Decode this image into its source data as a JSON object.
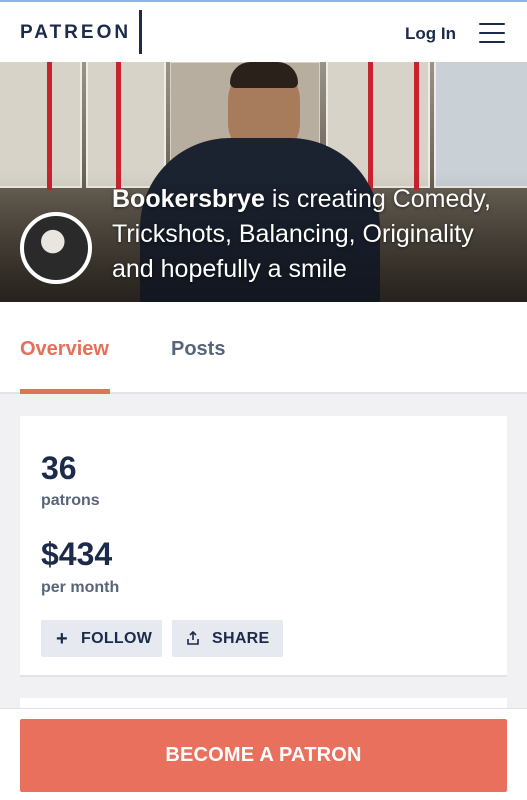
{
  "header": {
    "logo": "PATREON",
    "login_label": "Log In",
    "menu_icon": "hamburger-icon"
  },
  "hero": {
    "creator_name": "Bookersbrye",
    "tagline_prefix": "is creating",
    "tagline": "Comedy, Trickshots, Balancing, Originality and hopefully a smile"
  },
  "tabs": [
    {
      "label": "Overview",
      "active": true
    },
    {
      "label": "Posts",
      "active": false
    }
  ],
  "stats": {
    "patrons_count": "36",
    "patrons_label": "patrons",
    "earnings": "$434",
    "earnings_label": "per month"
  },
  "actions": {
    "follow_label": "FOLLOW",
    "follow_icon": "plus-icon",
    "share_label": "SHARE",
    "share_icon": "share-icon"
  },
  "footer": {
    "cta_label": "BECOME A PATRON"
  },
  "colors": {
    "accent": "#e8705c",
    "navy": "#1c2b4a"
  }
}
